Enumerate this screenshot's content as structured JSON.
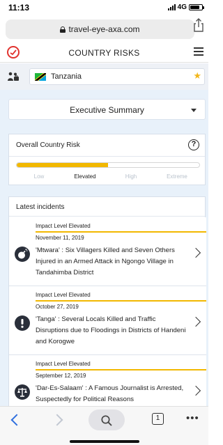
{
  "status_bar": {
    "time": "11:13",
    "network": "4G",
    "battery_level": 0.8
  },
  "browser": {
    "url": "travel-eye-axa.com"
  },
  "app": {
    "title": "COUNTRY RISKS"
  },
  "country": {
    "name": "Tanzania",
    "favorite": true
  },
  "summary": {
    "selected": "Executive Summary"
  },
  "risk": {
    "title": "Overall Country Risk",
    "levels": [
      "Low",
      "Elevated",
      "High",
      "Extreme"
    ],
    "current_level": "Elevated",
    "fill_fraction": 0.5
  },
  "incidents": {
    "title": "Latest incidents",
    "items": [
      {
        "impact": "Impact Level Elevated",
        "date": "November 11, 2019",
        "text": "'Mtwara' : Six Villagers Killed and Seven Others Injured in an Armed Attack in Ngongo Village in Tandahimba District",
        "icon": "bomb-icon"
      },
      {
        "impact": "Impact Level Elevated",
        "date": "October 27, 2019",
        "text": "'Tanga' : Several Locals Killed and Traffic Disruptions due to Floodings in Districts of Handeni and Korogwe",
        "icon": "exclamation-icon"
      },
      {
        "impact": "Impact Level Elevated",
        "date": "September 12, 2019",
        "text": "'Dar-Es-Salaam' : A Famous Journalist is Arrested, Suspectedly for Political Reasons",
        "icon": "justice-scale-icon"
      }
    ]
  },
  "toolbar": {
    "tab_count": "1"
  },
  "colors": {
    "accent": "#f2b800",
    "brand_red": "#e1332f",
    "link_blue": "#2f6fde",
    "content_bg": "#e8f1fa"
  }
}
